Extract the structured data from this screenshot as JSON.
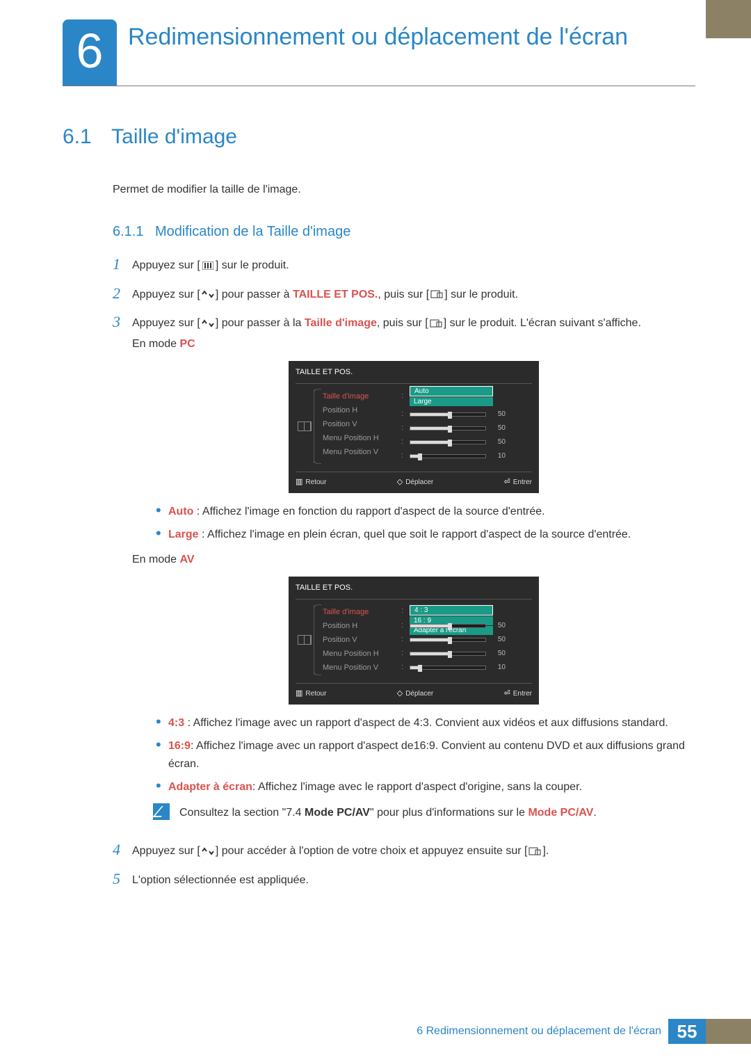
{
  "chapter": {
    "number": "6",
    "title": "Redimensionnement ou déplacement de l'écran"
  },
  "section": {
    "number": "6.1",
    "title": "Taille d'image",
    "intro": "Permet de modifier la taille de l'image."
  },
  "subsection": {
    "number": "6.1.1",
    "title": "Modification de la Taille d'image"
  },
  "steps": {
    "s1": {
      "num": "1",
      "pre": "Appuyez sur [",
      "post": "] sur le produit."
    },
    "s2": {
      "num": "2",
      "pre": "Appuyez sur [",
      "mid1": "] pour passer à ",
      "kw": "TAILLE ET POS.",
      "mid2": ", puis sur [",
      "post": "] sur le produit."
    },
    "s3": {
      "num": "3",
      "pre": "Appuyez sur [",
      "mid1": "] pour passer à la ",
      "kw": "Taille d'image",
      "mid2": ", puis sur [",
      "post": "] sur le produit. L'écran suivant s'affiche.",
      "mode_pc_pre": "En mode ",
      "mode_pc_kw": "PC",
      "mode_av_pre": "En mode ",
      "mode_av_kw": "AV"
    },
    "s4": {
      "num": "4",
      "pre": "Appuyez sur [",
      "mid": "] pour accéder à l'option de votre choix et appuyez ensuite sur [",
      "post": "]."
    },
    "s5": {
      "num": "5",
      "text": "L'option sélectionnée est appliquée."
    }
  },
  "osd": {
    "title": "TAILLE ET POS.",
    "items": {
      "taille": "Taille d'image",
      "posH": "Position H",
      "posV": "Position V",
      "menuH": "Menu Position H",
      "menuV": "Menu Position V"
    },
    "pc_options": {
      "opt1": "Auto",
      "opt2": "Large"
    },
    "av_options": {
      "opt1": "4 : 3",
      "opt2": "16 : 9",
      "opt3": "Adapter à l'écran"
    },
    "sliders": {
      "posH": "50",
      "posV": "50",
      "menuH": "50",
      "menuV": "10"
    },
    "footer": {
      "retour": "Retour",
      "deplacer": "Déplacer",
      "entrer": "Entrer"
    }
  },
  "bullets_pc": {
    "b1": {
      "kw": "Auto",
      "text": " : Affichez l'image en fonction du rapport d'aspect de la source d'entrée."
    },
    "b2": {
      "kw": "Large",
      "text": " : Affichez l'image en plein écran, quel que soit le rapport d'aspect de la source d'entrée."
    }
  },
  "bullets_av": {
    "b1": {
      "kw": "4:3",
      "text": " : Affichez l'image avec un rapport d'aspect de 4:3. Convient aux vidéos et aux diffusions standard."
    },
    "b2": {
      "kw": "16:9",
      "text": ": Affichez l'image avec un rapport d'aspect de16:9. Convient au contenu DVD et aux diffusions grand écran."
    },
    "b3": {
      "kw": "Adapter à écran",
      "text": ": Affichez l'image avec le rapport d'aspect d'origine, sans la couper."
    }
  },
  "note": {
    "pre": "Consultez la section \"7.4 ",
    "kw1": "Mode PC/AV",
    "mid": "\" pour plus d'informations sur le ",
    "kw2": "Mode PC/AV",
    "post": "."
  },
  "footer": {
    "text": "6 Redimensionnement ou déplacement de l'écran",
    "page": "55"
  }
}
